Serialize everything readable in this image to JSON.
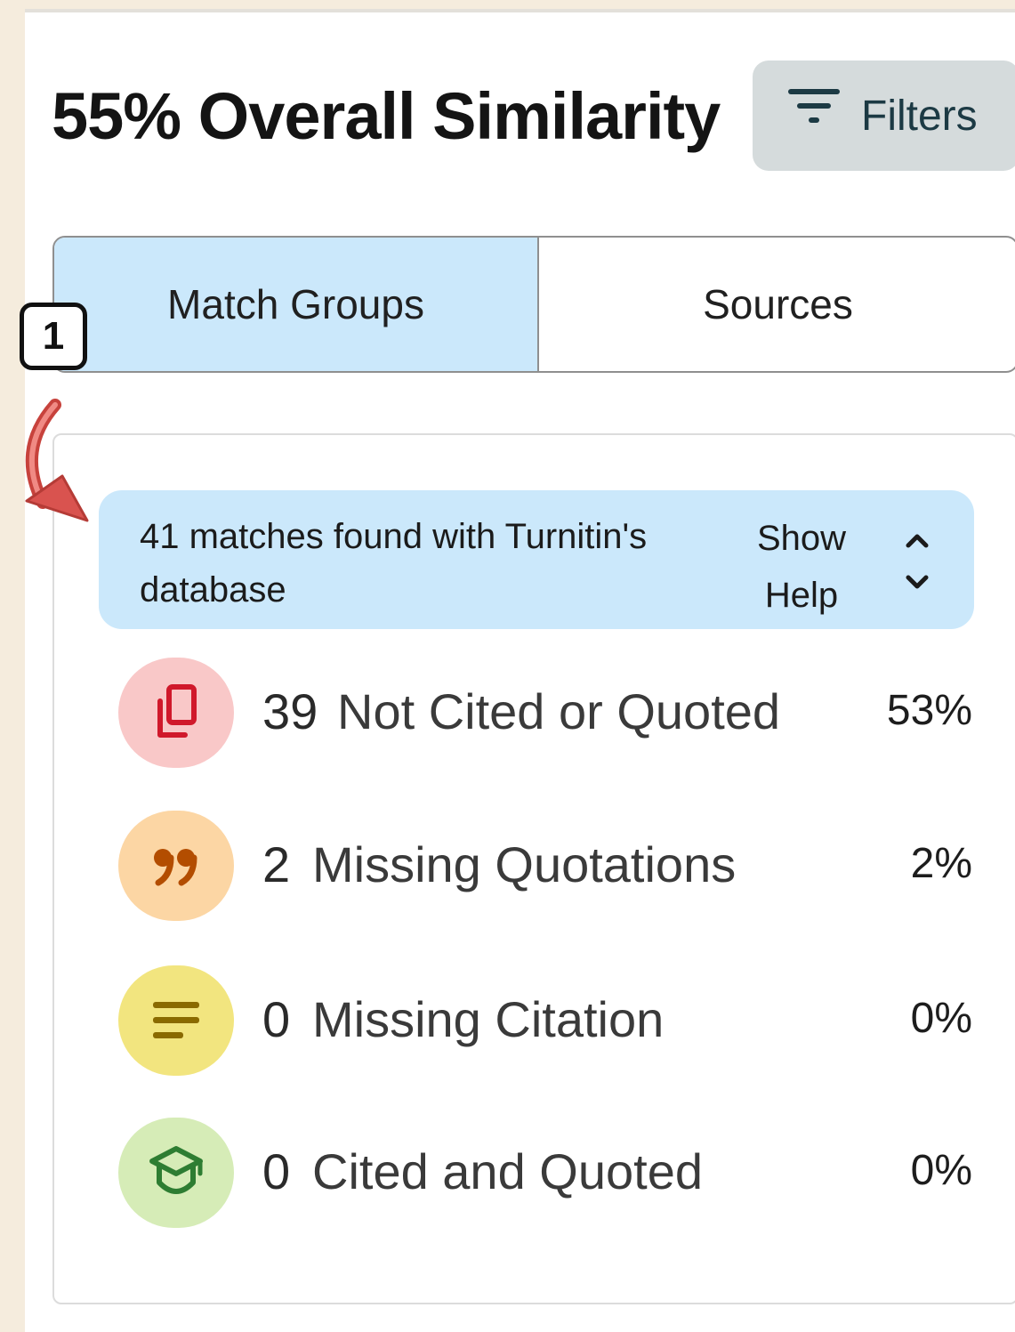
{
  "header": {
    "title": "55% Overall Similarity",
    "filters_label": "Filters",
    "filters_icon": "filter-lines-icon"
  },
  "tabs": [
    {
      "label": "Match Groups",
      "selected": true
    },
    {
      "label": "Sources",
      "selected": false
    }
  ],
  "annotation": {
    "step_number": "1",
    "arrow_color": "#d9534f"
  },
  "banner": {
    "text": "41 matches found with Turnitin's database",
    "help_line1": "Show",
    "help_line2": "Help",
    "chevron_icon": "chevron-up-down-icon"
  },
  "match_groups": [
    {
      "count": "39",
      "label": "Not Cited or Quoted",
      "percent": "53%",
      "icon": "copy-pages-icon",
      "icon_bg": "#f9c8c8",
      "icon_color": "#d0192b"
    },
    {
      "count": "2",
      "label": "Missing Quotations",
      "percent": "2%",
      "icon": "quote-marks-icon",
      "icon_bg": "#fcd6a4",
      "icon_color": "#b34d00"
    },
    {
      "count": "0",
      "label": "Missing Citation",
      "percent": "0%",
      "icon": "text-lines-icon",
      "icon_bg": "#f2e57f",
      "icon_color": "#8a6a00"
    },
    {
      "count": "0",
      "label": "Cited and Quoted",
      "percent": "0%",
      "icon": "graduation-cap-icon",
      "icon_bg": "#d6ecb7",
      "icon_color": "#2e7d32"
    }
  ],
  "colors": {
    "selected_tab": "#cbe8fb",
    "banner_bg": "#cbe8fb",
    "filters_bg": "#d5dbdc",
    "page_bg": "#f5ecdd"
  }
}
